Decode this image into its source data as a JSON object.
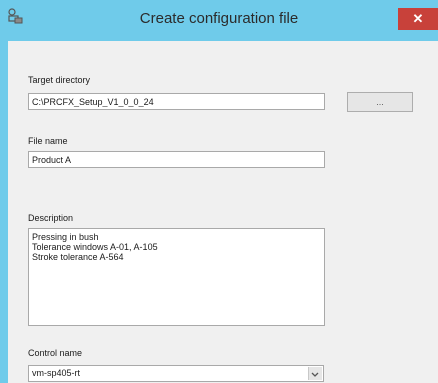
{
  "window": {
    "title": "Create configuration file",
    "close_glyph": "✕",
    "icon": "app-config-icon",
    "accent_color": "#6fcbea",
    "close_color": "#c8413a"
  },
  "form": {
    "target_directory": {
      "label": "Target directory",
      "value": "C:\\PRCFX_Setup_V1_0_0_24"
    },
    "browse_button": {
      "label": "..."
    },
    "file_name": {
      "label": "File name",
      "value": "Product A"
    },
    "description": {
      "label": "Description",
      "value": "Pressing in bush\nTolerance windows A-01, A-105\nStroke tolerance A-564"
    },
    "control_name": {
      "label": "Control name",
      "value": "vm-sp405-rt",
      "icon": "chevron-down-icon"
    }
  }
}
